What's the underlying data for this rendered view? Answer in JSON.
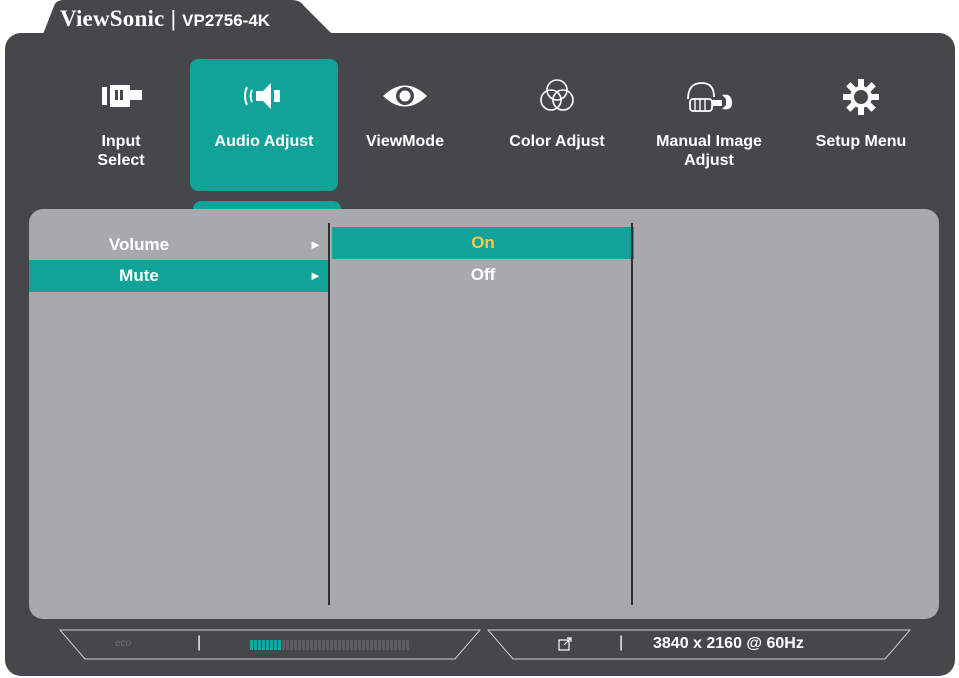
{
  "brand": {
    "name": "ViewSonic",
    "separator": "|",
    "model": "VP2756-4K"
  },
  "tabs": [
    {
      "label": "Input\nSelect",
      "icon": "input-select-icon",
      "active": false
    },
    {
      "label": "Audio Adjust",
      "icon": "speaker-icon",
      "active": true
    },
    {
      "label": "ViewMode",
      "icon": "eye-icon",
      "active": false
    },
    {
      "label": "Color Adjust",
      "icon": "color-circles-icon",
      "active": false
    },
    {
      "label": "Manual Image\nAdjust",
      "icon": "hand-wrench-icon",
      "active": false
    },
    {
      "label": "Setup Menu",
      "icon": "gear-icon",
      "active": false
    }
  ],
  "menu": {
    "items": [
      {
        "label": "Volume",
        "arrow": "►",
        "selected": false
      },
      {
        "label": "Mute",
        "arrow": "►",
        "selected": true
      }
    ],
    "options": [
      {
        "label": "On",
        "selected": true
      },
      {
        "label": "Off",
        "selected": false
      }
    ]
  },
  "status": {
    "eco_label": "eco",
    "separator": "|",
    "volume_level": 0.2,
    "resolution": "3840 x 2160 @ 60Hz"
  },
  "colors": {
    "accent": "#11a397",
    "frame": "#45474a",
    "panel": "#a8a9ad",
    "highlight_text": "#f2c94c"
  }
}
